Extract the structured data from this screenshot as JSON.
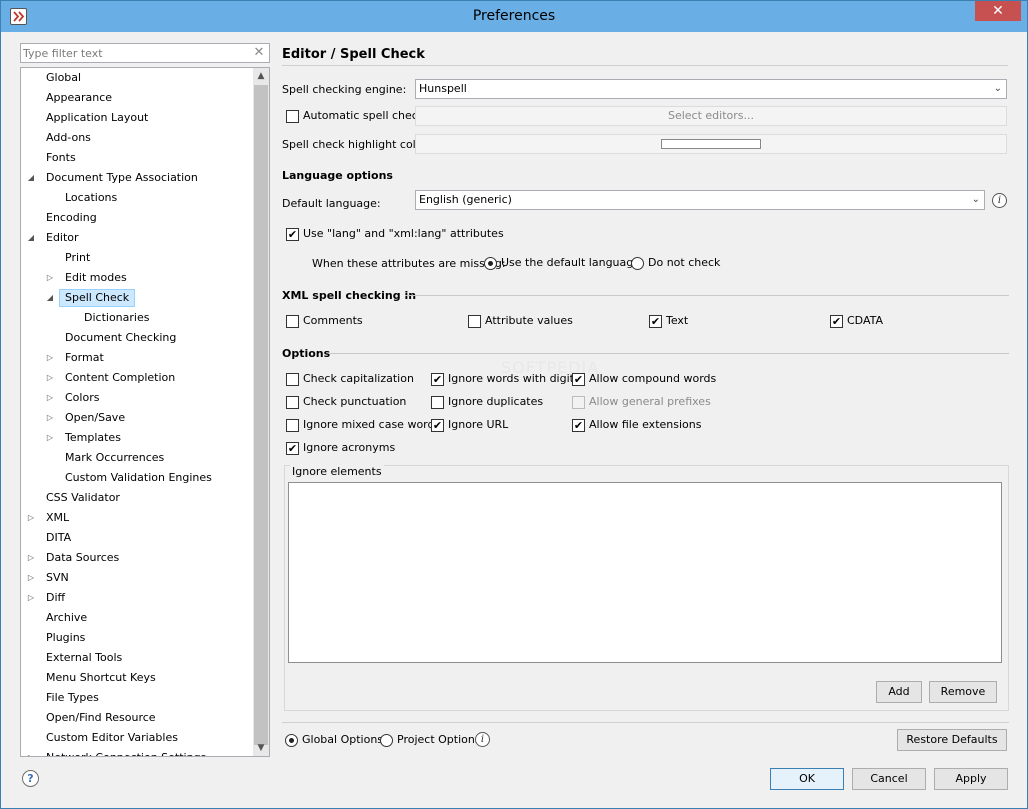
{
  "window": {
    "title": "Preferences",
    "close_glyph": "✕"
  },
  "filter": {
    "placeholder": "Type filter text"
  },
  "tree": {
    "items": [
      {
        "label": "Global",
        "indent": 0,
        "arrow": ""
      },
      {
        "label": "Appearance",
        "indent": 0,
        "arrow": ""
      },
      {
        "label": "Application Layout",
        "indent": 0,
        "arrow": ""
      },
      {
        "label": "Add-ons",
        "indent": 0,
        "arrow": ""
      },
      {
        "label": "Fonts",
        "indent": 0,
        "arrow": ""
      },
      {
        "label": "Document Type Association",
        "indent": 0,
        "arrow": "expanded"
      },
      {
        "label": "Locations",
        "indent": 1,
        "arrow": ""
      },
      {
        "label": "Encoding",
        "indent": 0,
        "arrow": ""
      },
      {
        "label": "Editor",
        "indent": 0,
        "arrow": "expanded"
      },
      {
        "label": "Print",
        "indent": 1,
        "arrow": ""
      },
      {
        "label": "Edit modes",
        "indent": 1,
        "arrow": "collapsed"
      },
      {
        "label": "Spell Check",
        "indent": 1,
        "arrow": "expanded",
        "selected": true
      },
      {
        "label": "Dictionaries",
        "indent": 2,
        "arrow": ""
      },
      {
        "label": "Document Checking",
        "indent": 1,
        "arrow": ""
      },
      {
        "label": "Format",
        "indent": 1,
        "arrow": "collapsed"
      },
      {
        "label": "Content Completion",
        "indent": 1,
        "arrow": "collapsed"
      },
      {
        "label": "Colors",
        "indent": 1,
        "arrow": "collapsed"
      },
      {
        "label": "Open/Save",
        "indent": 1,
        "arrow": "collapsed"
      },
      {
        "label": "Templates",
        "indent": 1,
        "arrow": "collapsed"
      },
      {
        "label": "Mark Occurrences",
        "indent": 1,
        "arrow": ""
      },
      {
        "label": "Custom Validation Engines",
        "indent": 1,
        "arrow": ""
      },
      {
        "label": "CSS Validator",
        "indent": 0,
        "arrow": ""
      },
      {
        "label": "XML",
        "indent": 0,
        "arrow": "collapsed"
      },
      {
        "label": "DITA",
        "indent": 0,
        "arrow": ""
      },
      {
        "label": "Data Sources",
        "indent": 0,
        "arrow": "collapsed"
      },
      {
        "label": "SVN",
        "indent": 0,
        "arrow": "collapsed"
      },
      {
        "label": "Diff",
        "indent": 0,
        "arrow": "collapsed"
      },
      {
        "label": "Archive",
        "indent": 0,
        "arrow": ""
      },
      {
        "label": "Plugins",
        "indent": 0,
        "arrow": ""
      },
      {
        "label": "External Tools",
        "indent": 0,
        "arrow": ""
      },
      {
        "label": "Menu Shortcut Keys",
        "indent": 0,
        "arrow": ""
      },
      {
        "label": "File Types",
        "indent": 0,
        "arrow": ""
      },
      {
        "label": "Open/Find Resource",
        "indent": 0,
        "arrow": ""
      },
      {
        "label": "Custom Editor Variables",
        "indent": 0,
        "arrow": ""
      },
      {
        "label": "Network Connection Settings",
        "indent": 0,
        "arrow": "collapsed"
      }
    ]
  },
  "page": {
    "title": "Editor / Spell Check",
    "engine_label": "Spell checking engine:",
    "engine_value": "Hunspell",
    "auto_check_label": "Automatic spell check:",
    "auto_check_checked": false,
    "select_editors_label": "Select editors...",
    "highlight_label": "Spell check highlight color:",
    "language_section": "Language options",
    "default_language_label": "Default language:",
    "default_language_value": "English (generic)",
    "use_lang_label": "Use \"lang\" and \"xml:lang\" attributes",
    "use_lang_checked": true,
    "missing_label": "When these attributes are missing:",
    "missing_options": [
      {
        "label": "Use the default language",
        "selected": true
      },
      {
        "label": "Do not check",
        "selected": false
      }
    ],
    "xml_section": "XML spell checking in",
    "xml_options": [
      {
        "label": "Comments",
        "checked": false
      },
      {
        "label": "Attribute values",
        "checked": false
      },
      {
        "label": "Text",
        "checked": true
      },
      {
        "label": "CDATA",
        "checked": true
      }
    ],
    "options_section": "Options",
    "options": [
      {
        "label": "Check capitalization",
        "checked": false,
        "disabled": false
      },
      {
        "label": "Ignore words with digits",
        "checked": true,
        "disabled": false
      },
      {
        "label": "Allow compound words",
        "checked": true,
        "disabled": false
      },
      {
        "label": "Check punctuation",
        "checked": false,
        "disabled": false
      },
      {
        "label": "Ignore duplicates",
        "checked": false,
        "disabled": false
      },
      {
        "label": "Allow general prefixes",
        "checked": false,
        "disabled": true
      },
      {
        "label": "Ignore mixed case words",
        "checked": false,
        "disabled": false
      },
      {
        "label": "Ignore URL",
        "checked": true,
        "disabled": false
      },
      {
        "label": "Allow file extensions",
        "checked": true,
        "disabled": false
      },
      {
        "label": "Ignore acronyms",
        "checked": true,
        "disabled": false
      }
    ],
    "ignore_elements_label": "Ignore elements",
    "add_label": "Add",
    "remove_label": "Remove",
    "scope_options": [
      {
        "label": "Global Options",
        "selected": true
      },
      {
        "label": "Project Options",
        "selected": false
      }
    ],
    "restore_label": "Restore Defaults",
    "watermark": "SOFTPEDIA"
  },
  "footer": {
    "ok_label": "OK",
    "cancel_label": "Cancel",
    "apply_label": "Apply",
    "help_glyph": "?"
  },
  "check_glyph": "✔"
}
